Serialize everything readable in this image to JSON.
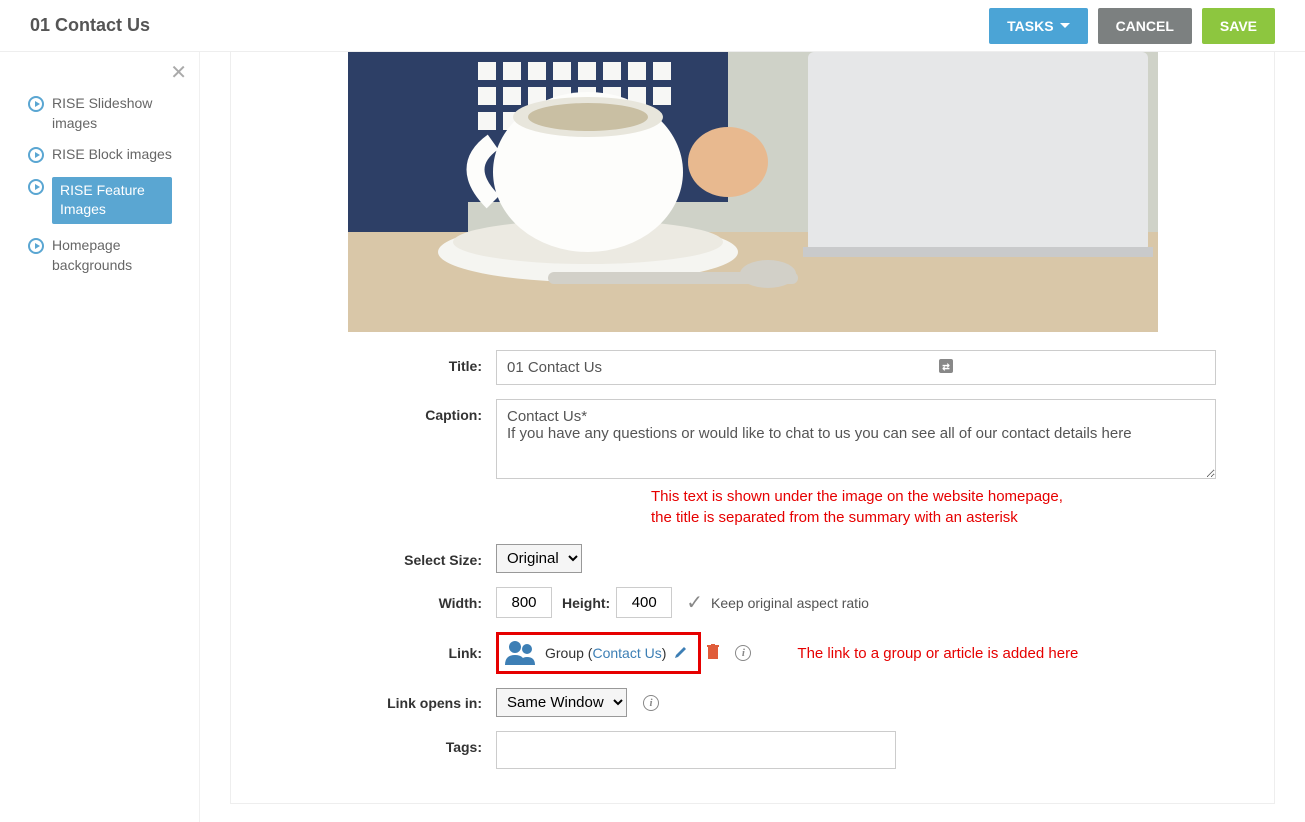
{
  "header": {
    "title": "01 Contact Us",
    "buttons": {
      "tasks": "TASKS",
      "cancel": "CANCEL",
      "save": "SAVE"
    }
  },
  "sidebar": {
    "items": [
      {
        "label": "RISE Slideshow images",
        "selected": false
      },
      {
        "label": "RISE Block images",
        "selected": false
      },
      {
        "label": "RISE Feature Images",
        "selected": true
      },
      {
        "label": "Homepage backgrounds",
        "selected": false
      }
    ]
  },
  "form": {
    "title_label": "Title:",
    "title_value": "01 Contact Us",
    "caption_label": "Caption:",
    "caption_value": "Contact Us*\nIf you have any questions or would like to chat to us you can see all of our contact details here",
    "caption_annotation": "This text is shown under the image on the website homepage,\nthe title is separated from the summary with an asterisk",
    "size_label": "Select Size:",
    "size_value": "Original",
    "width_label": "Width:",
    "width_value": "800",
    "height_label": "Height:",
    "height_value": "400",
    "aspect_label": "Keep original aspect ratio",
    "link_label": "Link:",
    "link_type": "Group",
    "link_target": "Contact Us",
    "link_annotation": "The link to a group or article is added here",
    "link_opens_label": "Link opens in:",
    "link_opens_value": "Same Window",
    "tags_label": "Tags:"
  }
}
